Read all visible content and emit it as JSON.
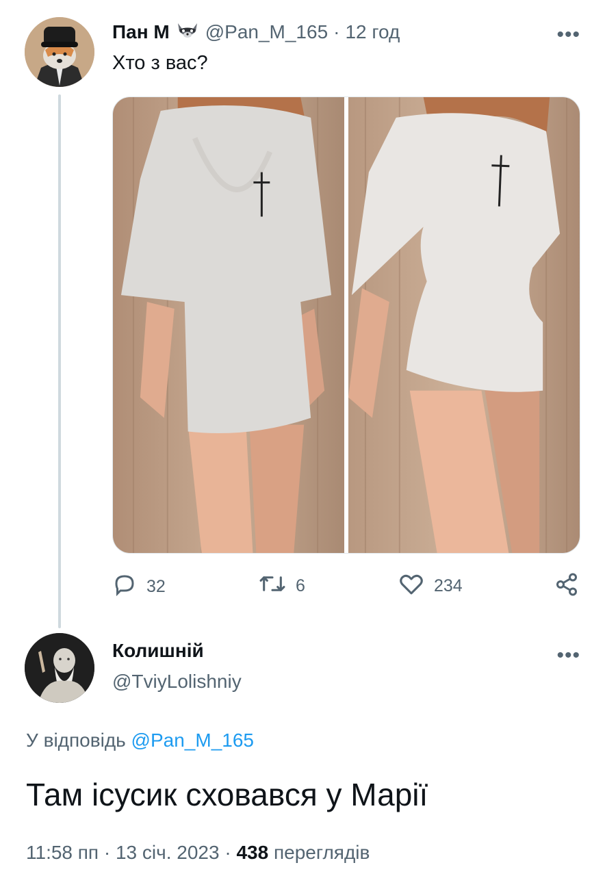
{
  "tweet1": {
    "author_name": "Пан М",
    "handle": "@Pan_M_165",
    "separator": "·",
    "time": "12 год",
    "more": "•••",
    "text": "Хто з вас?",
    "stats": {
      "replies": "32",
      "retweets": "6",
      "likes": "234"
    },
    "icons": [
      "raccoon-icon",
      "reply-icon",
      "retweet-icon",
      "like-icon",
      "share-icon",
      "more-icon"
    ]
  },
  "tweet2": {
    "author_name": "Колишній",
    "handle": "@TviyLolishniy",
    "more": "•••",
    "reply_prefix": "У відповідь",
    "reply_handle": "@Pan_M_165",
    "text": "Там ісусик сховався у Марії",
    "time": "11:58 пп",
    "sep1": "·",
    "date": "13 січ. 2023",
    "sep2": "·",
    "views_count": "438",
    "views_label": "переглядів"
  },
  "colors": {
    "text": "#0f1419",
    "muted": "#536471",
    "link": "#1d9bf0",
    "thread_line": "#cfd9de"
  }
}
